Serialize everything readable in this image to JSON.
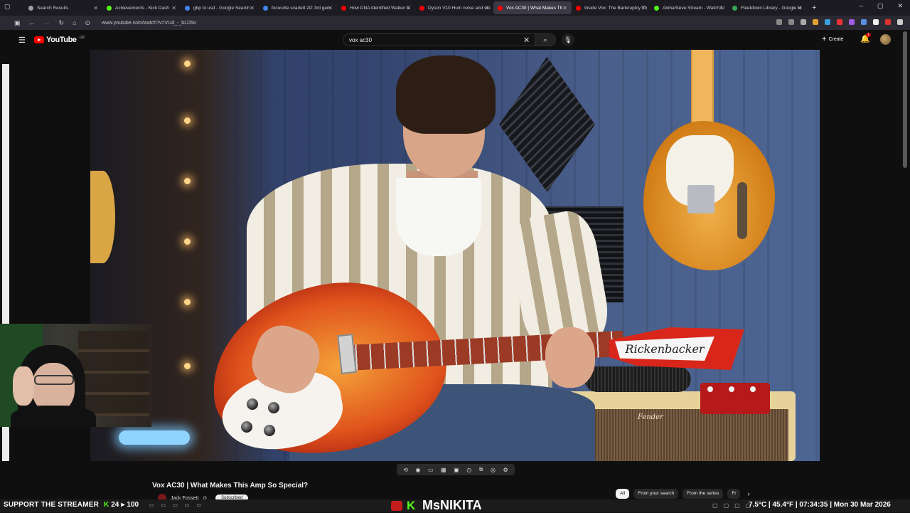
{
  "browser": {
    "tabs": [
      {
        "title": "Search Results",
        "color": "#9aa0a6"
      },
      {
        "title": "Achievements - Kick Dash",
        "color": "#53fc18"
      },
      {
        "title": "gbp to usd - Google Search",
        "color": "#4285f4"
      },
      {
        "title": "focusrite scarlett 2i2 3rd gen",
        "color": "#4285f4"
      },
      {
        "title": "How DNA Identified Walker C",
        "color": "#ff0000"
      },
      {
        "title": "Dyson V10 Hum noise and sto",
        "color": "#ff0000"
      },
      {
        "title": "Vox AC30 | What Makes Th",
        "color": "#ff0000",
        "active": true
      },
      {
        "title": "Inside Vox: The Bankruptcy Th",
        "color": "#ff0000"
      },
      {
        "title": "AlohaSteve Stream - Watch Li",
        "color": "#53fc18"
      },
      {
        "title": "Fleetdown Library - Google M",
        "color": "#34a853"
      }
    ],
    "url": "www.youtube.com/watch?v=VUd_-_bLD5o"
  },
  "youtube": {
    "logo_text": "YouTube",
    "logo_country": "GB",
    "search_value": "vox ac30",
    "create_label": "Create",
    "notification_count": "1"
  },
  "video": {
    "title": "Vox AC30 | What Makes This Amp So Special?",
    "channel": "Jack Fossett",
    "subscribe_label": "Subscribed",
    "headstock_brand": "Rickenbacker",
    "amp_brand": "Fender"
  },
  "chips": {
    "all": "All",
    "from_search": "From your search",
    "from_series": "From the series",
    "partial": "Fr"
  },
  "overlay": {
    "support_text": "SUPPORT THE STREAMER",
    "count_current": "24",
    "count_total": "100",
    "streamer_name": "MsNIKITA",
    "weather": "7.5°C | 45.4°F | 07:34:35 | Mon 30 Mar 2026"
  }
}
